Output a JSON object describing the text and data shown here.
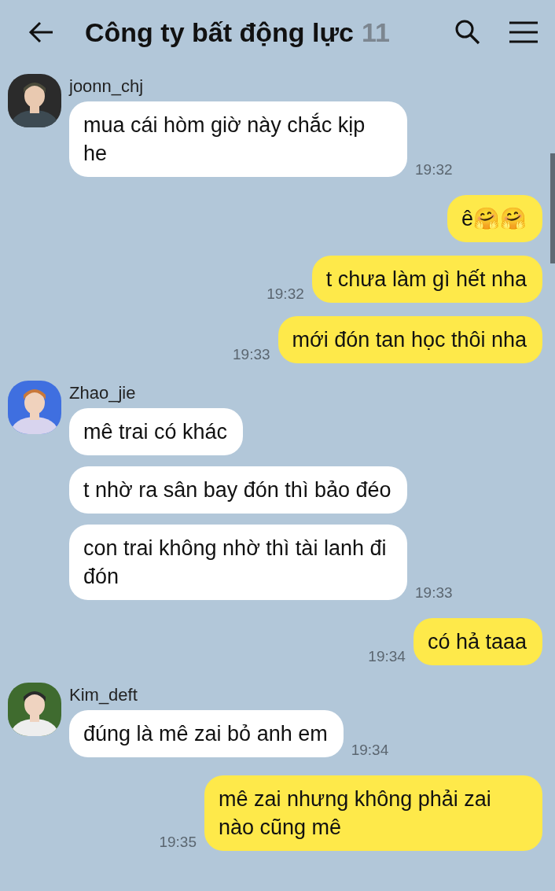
{
  "header": {
    "title": "Công ty bất động lực",
    "member_count": "11"
  },
  "groups": [
    {
      "kind": "received",
      "sender": "joonn_chj",
      "messages": [
        {
          "text": "mua cái hòm giờ này chắc kịp he",
          "time": "19:32"
        }
      ]
    },
    {
      "kind": "sent",
      "messages": [
        {
          "text": "ê🤗🤗"
        },
        {
          "text": "t chưa làm gì hết nha",
          "time": "19:32"
        },
        {
          "text": "mới đón tan học thôi nha",
          "time": "19:33"
        }
      ]
    },
    {
      "kind": "received",
      "sender": "Zhao_jie",
      "messages": [
        {
          "text": "mê trai có khác"
        },
        {
          "text": "t nhờ ra sân bay đón thì bảo đéo"
        },
        {
          "text": "con trai không nhờ thì tài lanh đi đón",
          "time": "19:33"
        }
      ]
    },
    {
      "kind": "sent",
      "messages": [
        {
          "text": "có hả taaa",
          "time": "19:34"
        }
      ]
    },
    {
      "kind": "received",
      "sender": "Kim_deft",
      "messages": [
        {
          "text": "đúng là mê zai bỏ anh em",
          "time": "19:34"
        }
      ]
    },
    {
      "kind": "sent",
      "messages": [
        {
          "text": "mê zai nhưng không phải zai nào cũng mê",
          "time": "19:35"
        }
      ]
    }
  ]
}
